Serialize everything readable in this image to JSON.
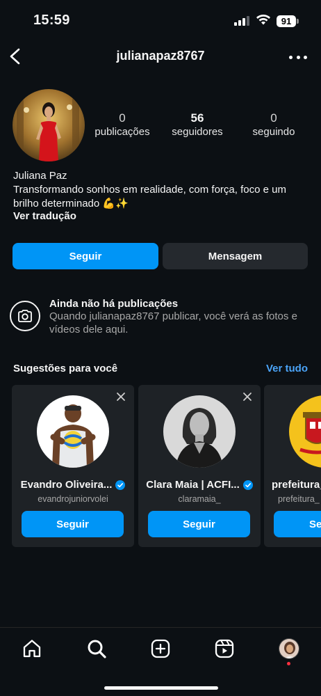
{
  "status_bar": {
    "time": "15:59",
    "battery": "91"
  },
  "header": {
    "username": "julianapaz8767"
  },
  "profile": {
    "stats": {
      "posts_value": "0",
      "posts_label": "publicações",
      "followers_value": "56",
      "followers_label": "seguidores",
      "following_value": "0",
      "following_label": "seguindo"
    },
    "full_name": "Juliana Paz",
    "bio": "Transformando sonhos em realidade, com força, foco e um brilho determinado 💪✨",
    "translate_label": "Ver tradução"
  },
  "actions": {
    "follow_label": "Seguir",
    "message_label": "Mensagem"
  },
  "empty_state": {
    "title": "Ainda não há publicações",
    "subtitle": "Quando julianapaz8767 publicar, você verá as fotos e vídeos dele aqui."
  },
  "suggestions": {
    "title": "Sugestões para você",
    "see_all": "Ver tudo",
    "cards": [
      {
        "name": "Evandro Oliveira...",
        "handle": "evandrojuniorvolei",
        "button": "Seguir",
        "verified": true
      },
      {
        "name": "Clara Maia | ACFI...",
        "handle": "claramaia_",
        "button": "Seguir",
        "verified": true
      },
      {
        "name": "prefeitura_",
        "handle": "prefeitura_",
        "button": "Se",
        "verified": false
      }
    ]
  },
  "colors": {
    "accent": "#0095f6",
    "background": "#0c1014",
    "card": "#1e2226",
    "link": "#4ba4f8"
  },
  "nav": {
    "icons": [
      "home-icon",
      "search-icon",
      "create-icon",
      "reels-icon",
      "profile-avatar"
    ]
  }
}
